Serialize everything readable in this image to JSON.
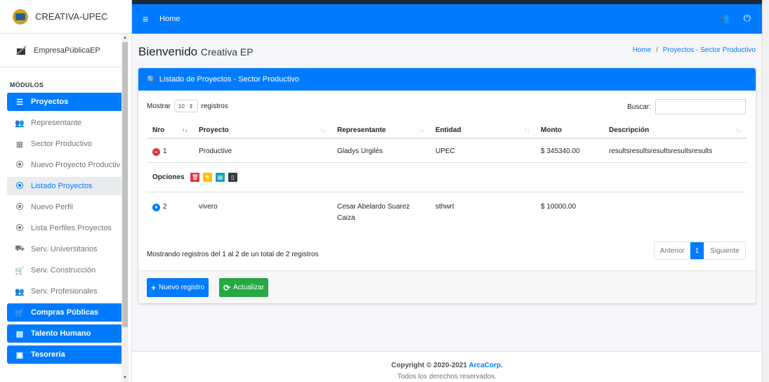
{
  "brand": {
    "name": "CREATIVA-UPEC"
  },
  "user": {
    "name": "EmpresaPúblicaEP"
  },
  "sidebar": {
    "header": "MÓDULOS",
    "items": [
      {
        "label": "Proyectos",
        "icon": "list-icon",
        "style": "primary"
      },
      {
        "label": "Representante",
        "icon": "users-icon"
      },
      {
        "label": "Sector Productivo",
        "icon": "warehouse-icon"
      },
      {
        "label": "Nuevo Proyecto Productiv",
        "icon": "radio-icon"
      },
      {
        "label": "Listado Proyectos",
        "icon": "radio-icon",
        "style": "active"
      },
      {
        "label": "Nuevo Perfil",
        "icon": "radio-icon"
      },
      {
        "label": "Lista Perfiles Proyectos",
        "icon": "radio-icon"
      },
      {
        "label": "Serv. Universitarios",
        "icon": "truck-icon"
      },
      {
        "label": "Serv. Construcción",
        "icon": "cart-icon"
      },
      {
        "label": "Serv. Profesionales",
        "icon": "users-icon"
      },
      {
        "label": "Compras Públicas",
        "icon": "cart-icon",
        "style": "primary"
      },
      {
        "label": "Talento Humano",
        "icon": "id-card-icon",
        "style": "primary"
      },
      {
        "label": "Tesoreria",
        "icon": "calendar-icon",
        "style": "primary"
      }
    ]
  },
  "topbar": {
    "home": "Home"
  },
  "page": {
    "title": "Bienvenido",
    "subtitle": "Creativa EP",
    "breadcrumb": {
      "home": "Home",
      "current": "Proyectos - Sector Productivo"
    }
  },
  "card": {
    "title": "Listado de Proyectos - Sector Productivo",
    "show_label": "Mostrar",
    "show_value": "10",
    "records_label": "registros",
    "search_label": "Buscar:",
    "columns": [
      "Nro",
      "Proyecto",
      "Representante",
      "Entidad",
      "Monto",
      "Descripción"
    ],
    "rows": [
      {
        "nro": "1",
        "proyecto": "Productive",
        "representante": "Gladys Urgilés",
        "entidad": "UPEC",
        "monto": "$ 345340.00",
        "descripcion": "resultsresultsresultsresultsresults"
      },
      {
        "nro": "2",
        "proyecto": "vivero",
        "representante": "Cesar Abelardo Suarez Caiza",
        "entidad": "sthwrt",
        "monto": "$ 10000.00",
        "descripcion": ""
      }
    ],
    "options_label": "Opciones",
    "info": "Mostrando registros del 1 al 2 de un total de 2 registros",
    "pager": {
      "prev": "Anterior",
      "current": "1",
      "next": "Siguiente"
    },
    "btn_new": "Nuevo registro",
    "btn_refresh": "Actualizar"
  },
  "footer": {
    "copyright": "Copyright © 2020-2021",
    "company": "ArcaCorp.",
    "rights": "Todos los derechos reservados."
  },
  "colors": {
    "primary": "#007bff",
    "success": "#28a745",
    "danger": "#dc3545",
    "warning": "#ffc107",
    "info": "#17a2b8"
  }
}
